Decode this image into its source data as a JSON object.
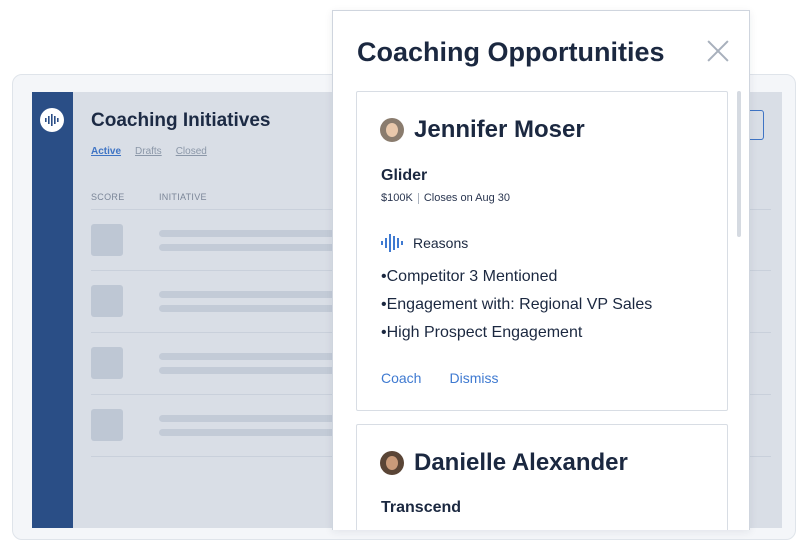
{
  "background": {
    "title": "Coaching Initiatives",
    "tabs": [
      {
        "label": "Active",
        "active": true
      },
      {
        "label": "Drafts",
        "active": false
      },
      {
        "label": "Closed",
        "active": false
      }
    ],
    "columns": {
      "score": "SCORE",
      "initiative": "INITIATIVE"
    },
    "brand_color": "#2a4e86"
  },
  "panel": {
    "title": "Coaching Opportunities",
    "close_icon": "close-icon",
    "cards": [
      {
        "person": "Jennifer Moser",
        "company": "Glider",
        "amount": "$100K",
        "closes": "Closes on Aug 30",
        "reasons_label": "Reasons",
        "reasons": [
          "Competitor 3 Mentioned",
          "Engagement with: Regional VP Sales",
          "High Prospect Engagement"
        ],
        "actions": {
          "coach": "Coach",
          "dismiss": "Dismiss"
        }
      },
      {
        "person": "Danielle Alexander",
        "company": "Transcend"
      }
    ],
    "link_color": "#3f7ad1"
  }
}
